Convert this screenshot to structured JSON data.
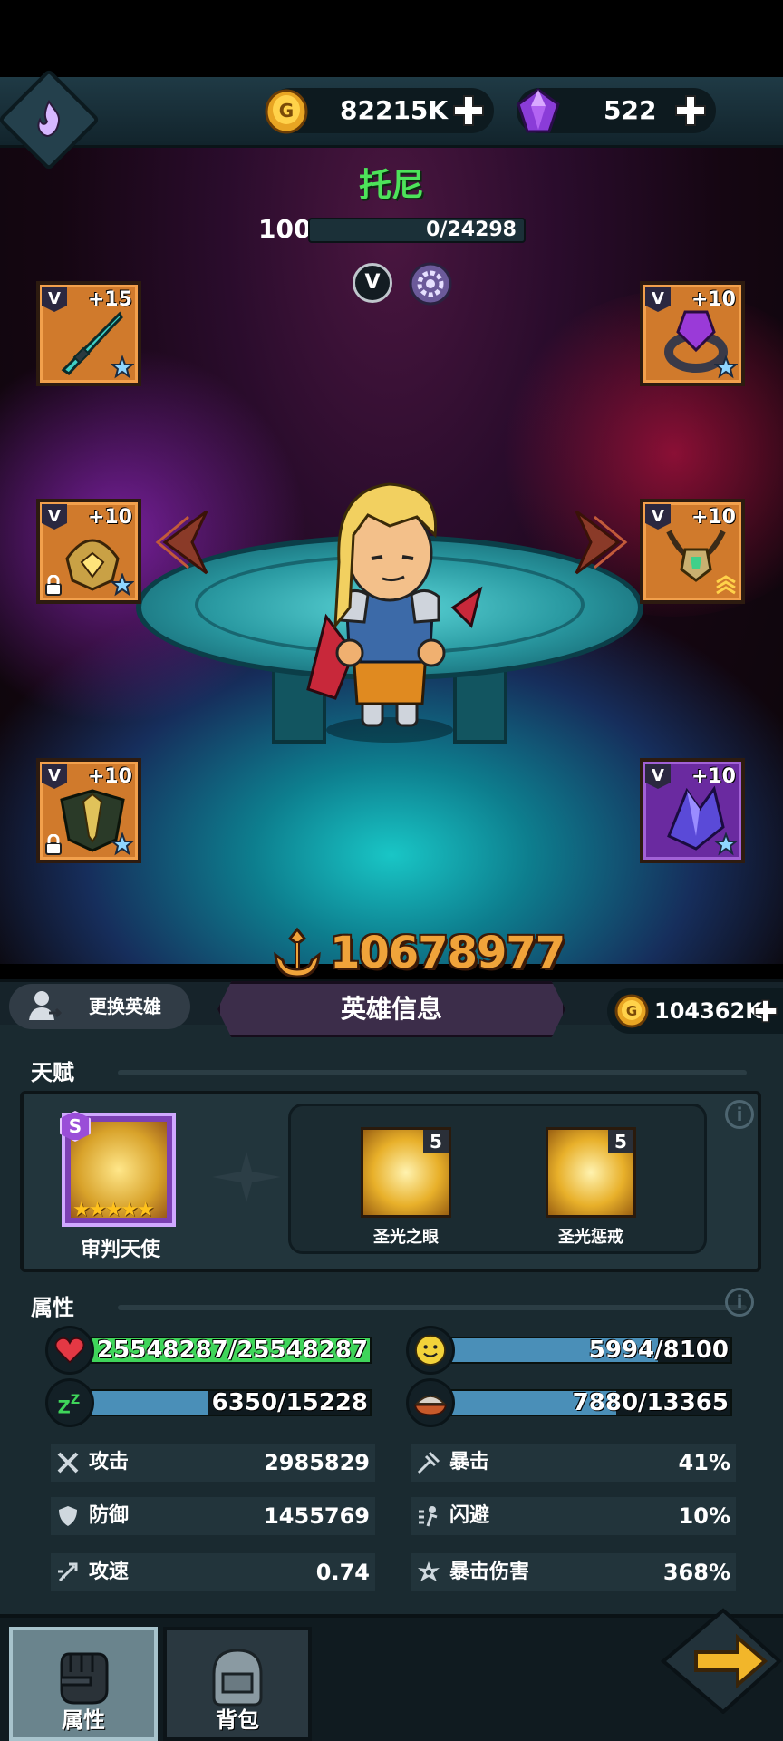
{
  "resources": {
    "gold": "82215K",
    "gems": "522"
  },
  "hero": {
    "name": "托尼",
    "level": "100",
    "exp": "0/24298",
    "tier_badge": "V",
    "power": "10678977"
  },
  "equipment": [
    {
      "slot": "weapon",
      "tier": "V",
      "enhance": "+15",
      "rarity": "orange"
    },
    {
      "slot": "helmet",
      "tier": "V",
      "enhance": "+10",
      "rarity": "orange"
    },
    {
      "slot": "armor",
      "tier": "V",
      "enhance": "+10",
      "rarity": "orange"
    },
    {
      "slot": "ring",
      "tier": "V",
      "enhance": "+10",
      "rarity": "orange"
    },
    {
      "slot": "necklace",
      "tier": "V",
      "enhance": "+10",
      "rarity": "orange"
    },
    {
      "slot": "gem",
      "tier": "V",
      "enhance": "+10",
      "rarity": "purple"
    }
  ],
  "strip": {
    "swap_label": "更换英雄",
    "title": "英雄信息",
    "gold": "104362K"
  },
  "talent": {
    "section_title": "天赋",
    "main": {
      "grade": "S",
      "name": "审判天使",
      "stars": "★★★★★"
    },
    "skills": [
      {
        "name": "圣光之眼",
        "level": "5"
      },
      {
        "name": "圣光惩戒",
        "level": "5"
      }
    ]
  },
  "attributes": {
    "section_title": "属性",
    "bars": [
      {
        "id": "hp",
        "icon": "heart-icon",
        "text": "25548287/25548287",
        "fill": 1.0,
        "color": "#3fd55a"
      },
      {
        "id": "mood",
        "icon": "smile-icon",
        "text": "5994/8100",
        "fill": 0.74,
        "color": "#4a8fb8"
      },
      {
        "id": "sleep",
        "icon": "sleep-icon",
        "text": "6350/15228",
        "fill": 0.42,
        "color": "#4a8fb8"
      },
      {
        "id": "food",
        "icon": "food-icon",
        "text": "7880/13365",
        "fill": 0.59,
        "color": "#4a8fb8"
      }
    ],
    "stats": [
      {
        "key": "攻击",
        "value": "2985829",
        "icon": "attack-icon"
      },
      {
        "key": "暴击",
        "value": "41%",
        "icon": "crit-icon"
      },
      {
        "key": "防御",
        "value": "1455769",
        "icon": "defense-icon"
      },
      {
        "key": "闪避",
        "value": "10%",
        "icon": "dodge-icon"
      },
      {
        "key": "攻速",
        "value": "0.74",
        "icon": "attack-speed-icon"
      },
      {
        "key": "暴击伤害",
        "value": "368%",
        "icon": "crit-damage-icon"
      }
    ]
  },
  "nav": {
    "tabs": [
      {
        "label": "属性",
        "active": true
      },
      {
        "label": "背包",
        "active": false
      }
    ]
  }
}
